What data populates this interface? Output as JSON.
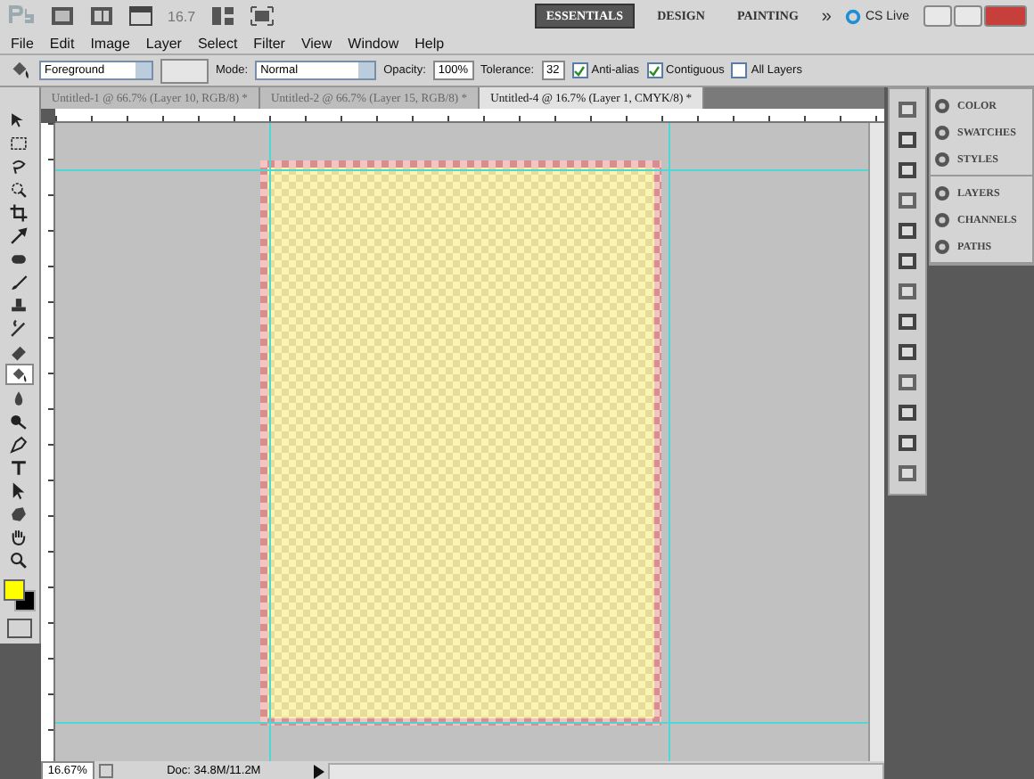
{
  "app_bar": {
    "zoom_value": "16.7",
    "workspaces": [
      {
        "label": "ESSENTIALS",
        "selected": true
      },
      {
        "label": "DESIGN",
        "selected": false
      },
      {
        "label": "PAINTING",
        "selected": false
      }
    ],
    "more": "»",
    "cs_live": "CS Live"
  },
  "menu": [
    "File",
    "Edit",
    "Image",
    "Layer",
    "Select",
    "Filter",
    "View",
    "Window",
    "Help"
  ],
  "options_bar": {
    "fill_source": "Foreground",
    "mode_label": "Mode:",
    "mode": "Normal",
    "opacity_label": "Opacity:",
    "opacity": "100%",
    "tolerance_label": "Tolerance:",
    "tolerance": "32",
    "checkboxes": [
      {
        "label": "Anti-alias",
        "checked": true
      },
      {
        "label": "Contiguous",
        "checked": true
      },
      {
        "label": "All Layers",
        "checked": false
      }
    ]
  },
  "tabs": [
    {
      "label": "Untitled-1 @ 66.7% (Layer 10, RGB/8) *",
      "selected": false
    },
    {
      "label": "Untitled-2 @ 66.7% (Layer 15, RGB/8) *",
      "selected": false
    },
    {
      "label": "Untitled-4 @ 16.7% (Layer 1, CMYK/8) *",
      "selected": true
    }
  ],
  "tools": [
    {
      "kind": "move",
      "selected": false
    },
    {
      "kind": "marquee",
      "selected": false
    },
    {
      "kind": "lasso",
      "selected": false
    },
    {
      "kind": "quick-select",
      "selected": false
    },
    {
      "kind": "crop",
      "selected": false
    },
    {
      "kind": "eyedropper",
      "selected": false
    },
    {
      "kind": "healing",
      "selected": false
    },
    {
      "kind": "brush",
      "selected": false
    },
    {
      "kind": "stamp",
      "selected": false
    },
    {
      "kind": "history",
      "selected": false
    },
    {
      "kind": "eraser",
      "selected": false
    },
    {
      "kind": "bucket",
      "selected": true
    },
    {
      "kind": "blur",
      "selected": false
    },
    {
      "kind": "dodge",
      "selected": false
    },
    {
      "kind": "pen",
      "selected": false
    },
    {
      "kind": "type",
      "selected": false
    },
    {
      "kind": "path-select",
      "selected": false
    },
    {
      "kind": "shape",
      "selected": false
    },
    {
      "kind": "hand",
      "selected": false
    },
    {
      "kind": "zoom",
      "selected": false
    }
  ],
  "panels": [
    [
      "COLOR",
      "SWATCHES",
      "STYLES"
    ],
    [
      "LAYERS",
      "CHANNELS",
      "PATHS"
    ]
  ],
  "status_bar": {
    "zoom": "16.67%",
    "doc_info": "Doc: 34.8M/11.2M"
  }
}
